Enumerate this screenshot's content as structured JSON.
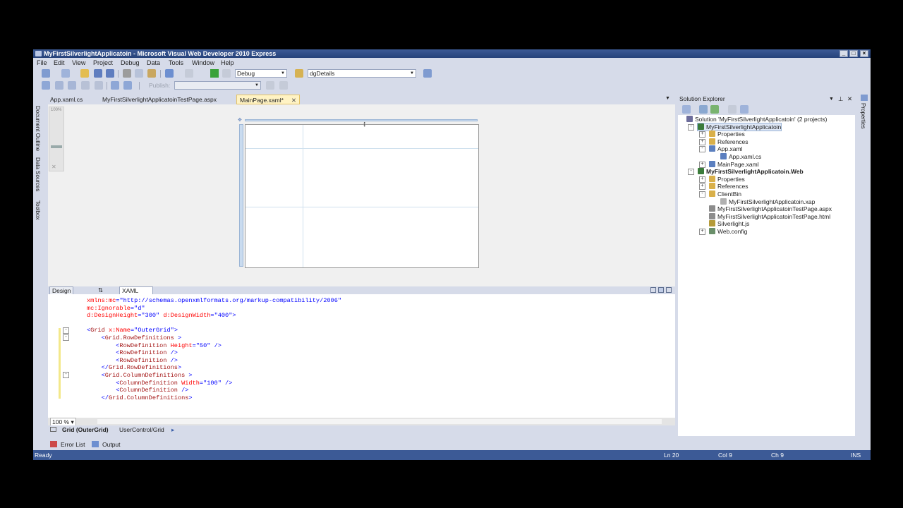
{
  "window": {
    "title": "MyFirstSilverlightApplicatoin - Microsoft Visual Web Developer 2010 Express",
    "controls": {
      "minimize": "_",
      "maximize": "□",
      "close": "×"
    }
  },
  "menu": [
    "File",
    "Edit",
    "View",
    "Project",
    "Debug",
    "Data",
    "Tools",
    "Window",
    "Help"
  ],
  "toolbar": {
    "config_combo": "Debug",
    "find_combo": "dgDetails",
    "publish_label": "Publish:"
  },
  "left_side_tabs": [
    "Document Outline",
    "Data Sources",
    "Toolbox"
  ],
  "right_side_tabs": [
    "Properties"
  ],
  "doc_tabs": [
    {
      "label": "App.xaml.cs"
    },
    {
      "label": "MyFirstSilverlightApplicatoinTestPage.aspx"
    },
    {
      "label": "MainPage.xaml*"
    }
  ],
  "designer": {
    "zoom_label": "100%"
  },
  "view_tabs": {
    "design": "Design",
    "swap": "⇅",
    "xaml": "XAML"
  },
  "code": {
    "lines": [
      {
        "parts": [
          [
            "attr",
            "xmlns:mc"
          ],
          [
            "pun",
            "="
          ],
          [
            "val",
            "\"http://schemas.openxmlformats.org/markup-compatibility/2006\""
          ]
        ]
      },
      {
        "parts": [
          [
            "attr",
            "mc:Ignorable"
          ],
          [
            "pun",
            "="
          ],
          [
            "val",
            "\"d\""
          ]
        ]
      },
      {
        "parts": [
          [
            "attr",
            "d:DesignHeight"
          ],
          [
            "pun",
            "="
          ],
          [
            "val",
            "\"300\""
          ],
          [
            "pun",
            " "
          ],
          [
            "attr",
            "d:DesignWidth"
          ],
          [
            "pun",
            "="
          ],
          [
            "val",
            "\"400\""
          ],
          [
            "pun",
            ">"
          ]
        ]
      },
      {
        "parts": []
      },
      {
        "parts": [
          [
            "pun",
            "<"
          ],
          [
            "tag",
            "Grid"
          ],
          [
            "pun",
            " "
          ],
          [
            "attr",
            "x:Name"
          ],
          [
            "pun",
            "="
          ],
          [
            "val",
            "\"OuterGrid\""
          ],
          [
            "pun",
            ">"
          ]
        ]
      },
      {
        "parts": [
          [
            "pun",
            "    <"
          ],
          [
            "tag",
            "Grid.RowDefinitions"
          ],
          [
            "pun",
            " >"
          ]
        ]
      },
      {
        "parts": [
          [
            "pun",
            "        <"
          ],
          [
            "tag",
            "RowDefinition"
          ],
          [
            "pun",
            " "
          ],
          [
            "attr",
            "Height"
          ],
          [
            "pun",
            "="
          ],
          [
            "val",
            "\"50\""
          ],
          [
            "pun",
            " />"
          ]
        ]
      },
      {
        "parts": [
          [
            "pun",
            "        <"
          ],
          [
            "tag",
            "RowDefinition"
          ],
          [
            "pun",
            " />"
          ]
        ]
      },
      {
        "parts": [
          [
            "pun",
            "        <"
          ],
          [
            "tag",
            "RowDefinition"
          ],
          [
            "pun",
            " />"
          ]
        ]
      },
      {
        "parts": [
          [
            "pun",
            "    </"
          ],
          [
            "tag",
            "Grid.RowDefinitions"
          ],
          [
            "pun",
            ">"
          ]
        ]
      },
      {
        "parts": [
          [
            "pun",
            "    <"
          ],
          [
            "tag",
            "Grid.ColumnDefinitions"
          ],
          [
            "pun",
            " >"
          ]
        ]
      },
      {
        "parts": [
          [
            "pun",
            "        <"
          ],
          [
            "tag",
            "ColumnDefinition"
          ],
          [
            "pun",
            " "
          ],
          [
            "attr",
            "Width"
          ],
          [
            "pun",
            "="
          ],
          [
            "val",
            "\"100\""
          ],
          [
            "pun",
            " />"
          ]
        ]
      },
      {
        "parts": [
          [
            "pun",
            "        <"
          ],
          [
            "tag",
            "ColumnDefinition"
          ],
          [
            "pun",
            " />"
          ]
        ]
      },
      {
        "parts": [
          [
            "pun",
            "    </"
          ],
          [
            "tag",
            "Grid.ColumnDefinitions"
          ],
          [
            "pun",
            ">"
          ]
        ]
      }
    ]
  },
  "code_zoom": "100 %",
  "path_bar": {
    "element": "Grid (OuterGrid)",
    "path": "UserControl/Grid"
  },
  "bottom_tabs": [
    "Error List",
    "Output"
  ],
  "status": {
    "left": "Ready",
    "ln": "Ln 20",
    "col": "Col 9",
    "ch": "Ch 9",
    "mode": "INS"
  },
  "solution_explorer": {
    "title": "Solution Explorer",
    "nodes": [
      {
        "label": "Solution 'MyFirstSilverlightApplicatoin' (2 projects)",
        "depth": 0,
        "icon": "solution-icon",
        "color": "#6d6d9c"
      },
      {
        "label": "MyFirstSilverlightApplicatoin",
        "depth": 1,
        "icon": "project-icon",
        "color": "#3a7b3a",
        "selected": true,
        "exp": "-"
      },
      {
        "label": "Properties",
        "depth": 2,
        "icon": "folder-icon",
        "color": "#d9b04a",
        "exp": "+"
      },
      {
        "label": "References",
        "depth": 2,
        "icon": "folder-icon",
        "color": "#d9b04a",
        "exp": "+"
      },
      {
        "label": "App.xaml",
        "depth": 2,
        "icon": "xaml-file-icon",
        "color": "#5b7fbf",
        "exp": "-"
      },
      {
        "label": "App.xaml.cs",
        "depth": 3,
        "icon": "cs-file-icon",
        "color": "#5b7fbf"
      },
      {
        "label": "MainPage.xaml",
        "depth": 2,
        "icon": "xaml-file-icon",
        "color": "#5b7fbf",
        "exp": "+"
      },
      {
        "label": "MyFirstSilverlightApplicatoin.Web",
        "depth": 1,
        "icon": "web-project-icon",
        "color": "#3a7b3a",
        "bold": true,
        "exp": "-"
      },
      {
        "label": "Properties",
        "depth": 2,
        "icon": "folder-icon",
        "color": "#d9b04a",
        "exp": "+"
      },
      {
        "label": "References",
        "depth": 2,
        "icon": "folder-icon",
        "color": "#d9b04a",
        "exp": "+"
      },
      {
        "label": "ClientBin",
        "depth": 2,
        "icon": "folder-icon",
        "color": "#d9b04a",
        "exp": "-"
      },
      {
        "label": "MyFirstSilverlightApplicatoin.xap",
        "depth": 3,
        "icon": "xap-file-icon",
        "color": "#b0b0b0"
      },
      {
        "label": "MyFirstSilverlightApplicatoinTestPage.aspx",
        "depth": 2,
        "icon": "aspx-file-icon",
        "color": "#8c8c8c"
      },
      {
        "label": "MyFirstSilverlightApplicatoinTestPage.html",
        "depth": 2,
        "icon": "html-file-icon",
        "color": "#8c8c8c"
      },
      {
        "label": "Silverlight.js",
        "depth": 2,
        "icon": "js-file-icon",
        "color": "#b59b3a"
      },
      {
        "label": "Web.config",
        "depth": 2,
        "icon": "config-file-icon",
        "color": "#6a8f6a",
        "exp": "+"
      }
    ]
  }
}
